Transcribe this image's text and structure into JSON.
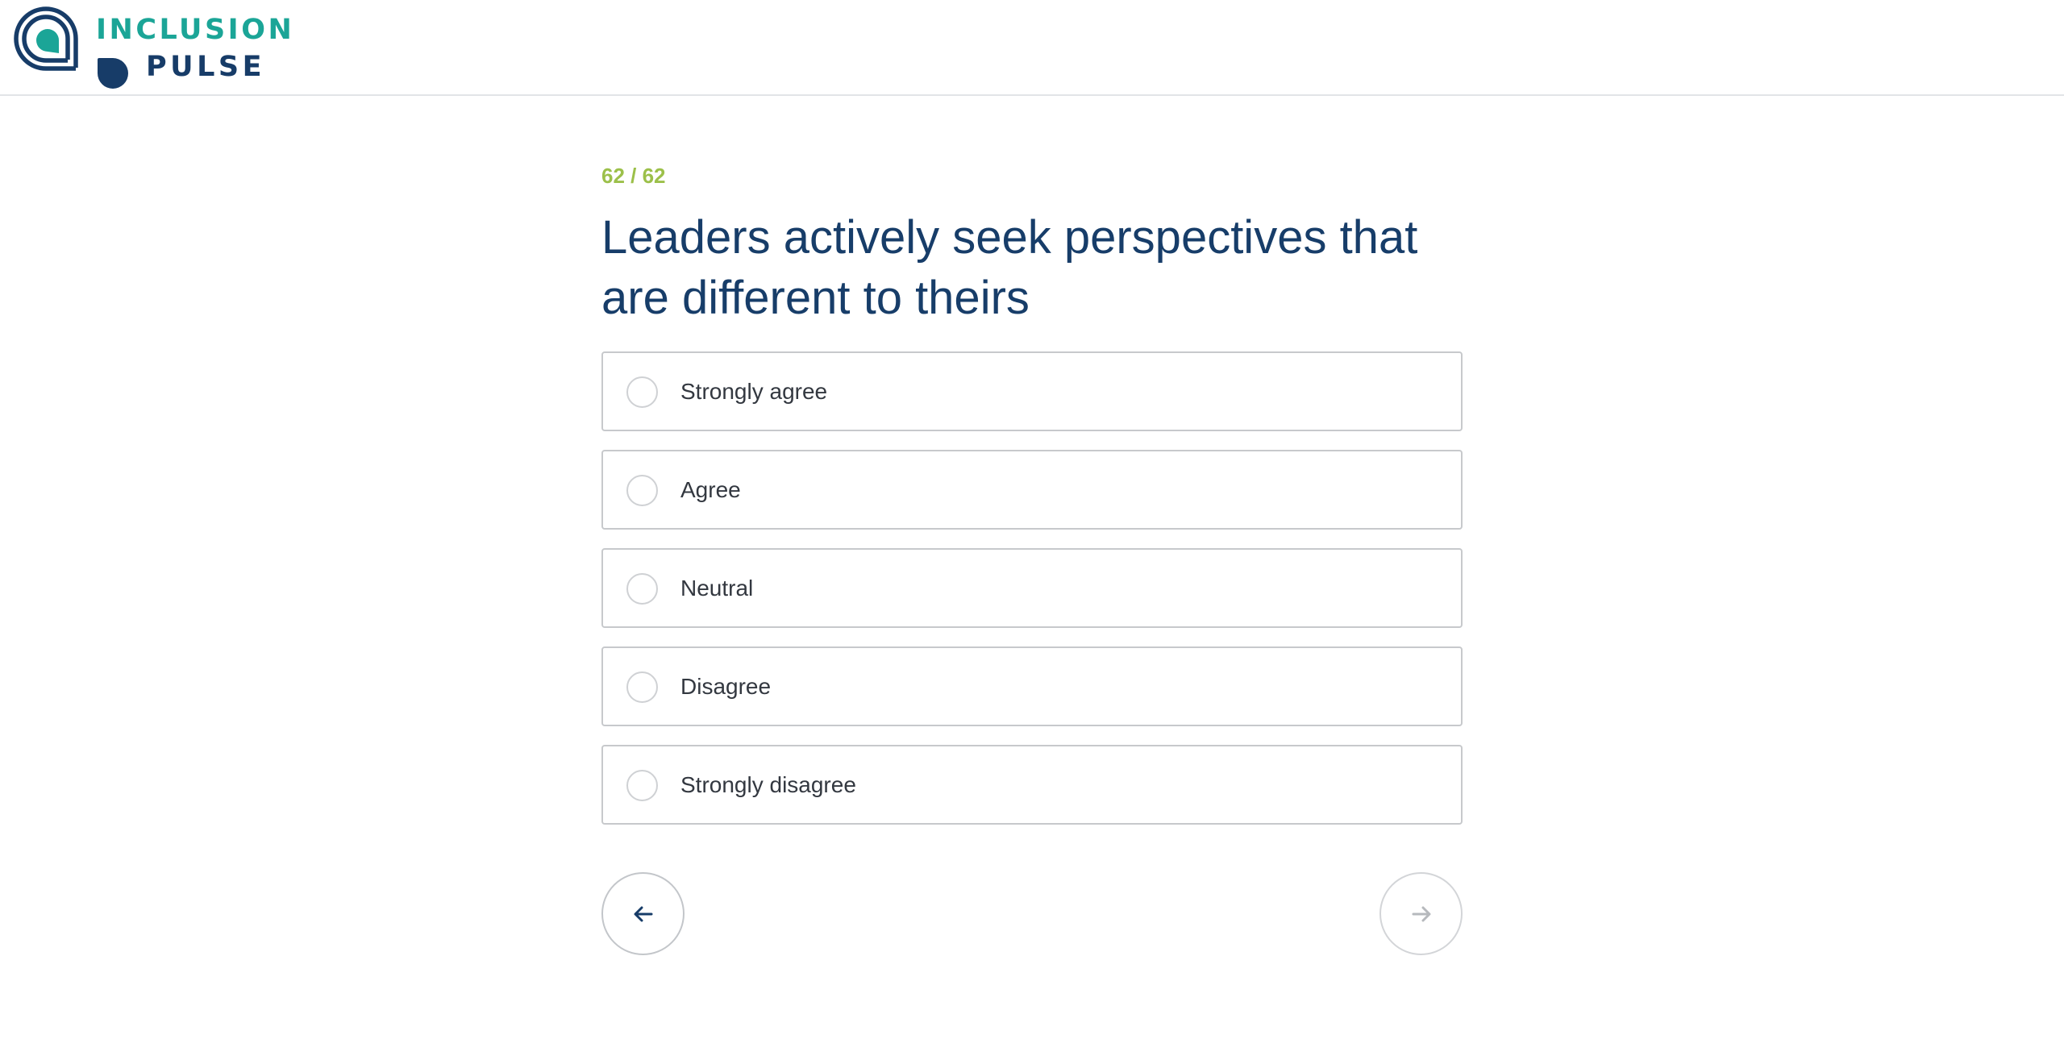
{
  "brand": {
    "line1": "INCLUSION",
    "line2": "PULSE",
    "colors": {
      "teal": "#1ba597",
      "navy": "#173c68"
    }
  },
  "survey": {
    "counter": "62 / 62",
    "question": "Leaders actively seek perspectives that are different to theirs",
    "options": [
      {
        "label": "Strongly agree",
        "selected": false
      },
      {
        "label": "Agree",
        "selected": false
      },
      {
        "label": "Neutral",
        "selected": false
      },
      {
        "label": "Disagree",
        "selected": false
      },
      {
        "label": "Strongly disagree",
        "selected": false
      }
    ],
    "colors": {
      "counter": "#9cc04a",
      "question": "#173d69"
    }
  },
  "navigation": {
    "back_icon": "arrow-left-icon",
    "next_icon": "arrow-right-icon",
    "next_enabled": false
  }
}
